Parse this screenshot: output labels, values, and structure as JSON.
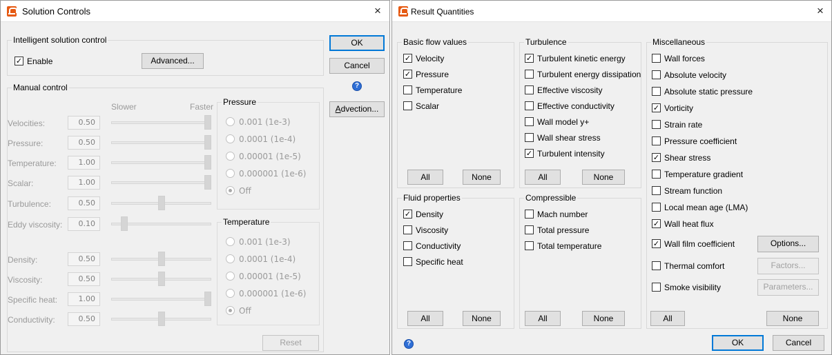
{
  "solution": {
    "title": "Solution Controls",
    "close": "×",
    "intelligent": {
      "label": "Intelligent solution control",
      "enable": "Enable",
      "enable_mark": "✓",
      "advanced": "Advanced..."
    },
    "manual": {
      "label": "Manual control",
      "slower": "Slower",
      "faster": "Faster",
      "rows": [
        {
          "label": "Velocities:",
          "value": "0.50",
          "slider": 1.0
        },
        {
          "label": "Pressure:",
          "value": "0.50",
          "slider": 1.0
        },
        {
          "label": "Temperature:",
          "value": "1.00",
          "slider": 1.0
        },
        {
          "label": "Scalar:",
          "value": "1.00",
          "slider": 1.0
        },
        {
          "label": "Turbulence:",
          "value": "0.50",
          "slider": 0.5
        },
        {
          "label": "Eddy viscosity:",
          "value": "0.10",
          "slider": 0.1
        },
        {
          "label": "Density:",
          "value": "0.50",
          "slider": 0.5
        },
        {
          "label": "Viscosity:",
          "value": "0.50",
          "slider": 0.5
        },
        {
          "label": "Specific heat:",
          "value": "1.00",
          "slider": 1.0
        },
        {
          "label": "Conductivity:",
          "value": "0.50",
          "slider": 0.5
        }
      ]
    },
    "pressure": {
      "label": "Pressure",
      "options": [
        "0.001 (1e-3)",
        "0.0001 (1e-4)",
        "0.00001 (1e-5)",
        "0.000001 (1e-6)",
        "Off"
      ],
      "selected": "Off"
    },
    "temperature": {
      "label": "Temperature",
      "options": [
        "0.001 (1e-3)",
        "0.0001 (1e-4)",
        "0.00001 (1e-5)",
        "0.000001 (1e-6)",
        "Off"
      ],
      "selected": "Off"
    },
    "buttons": {
      "ok": "OK",
      "cancel": "Cancel",
      "advection_a": "A",
      "advection_rest": "dvection...",
      "reset": "Reset"
    },
    "help": "?"
  },
  "results": {
    "title": "Result Quantities",
    "close": "×",
    "basic": {
      "label": "Basic flow values",
      "items": [
        {
          "label": "Velocity",
          "mark": "✓"
        },
        {
          "label": "Pressure",
          "mark": "✓"
        },
        {
          "label": "Temperature",
          "mark": ""
        },
        {
          "label": "Scalar",
          "mark": ""
        }
      ],
      "all": "All",
      "none": "None"
    },
    "turbulence": {
      "label": "Turbulence",
      "items": [
        {
          "label": "Turbulent kinetic energy",
          "mark": "✓"
        },
        {
          "label": "Turbulent energy dissipation",
          "mark": ""
        },
        {
          "label": "Effective viscosity",
          "mark": ""
        },
        {
          "label": "Effective conductivity",
          "mark": ""
        },
        {
          "label": "Wall model y+",
          "mark": ""
        },
        {
          "label": "Wall shear stress",
          "mark": ""
        },
        {
          "label": "Turbulent intensity",
          "mark": "✓"
        }
      ],
      "all": "All",
      "none": "None"
    },
    "fluid": {
      "label": "Fluid properties",
      "items": [
        {
          "label": "Density",
          "mark": "✓"
        },
        {
          "label": "Viscosity",
          "mark": ""
        },
        {
          "label": "Conductivity",
          "mark": ""
        },
        {
          "label": "Specific heat",
          "mark": ""
        }
      ],
      "all": "All",
      "none": "None"
    },
    "compressible": {
      "label": "Compressible",
      "items": [
        {
          "label": "Mach number",
          "mark": ""
        },
        {
          "label": "Total pressure",
          "mark": ""
        },
        {
          "label": "Total temperature",
          "mark": ""
        }
      ],
      "all": "All",
      "none": "None"
    },
    "misc": {
      "label": "Miscellaneous",
      "items": [
        {
          "label": "Wall forces",
          "mark": ""
        },
        {
          "label": "Absolute velocity",
          "mark": ""
        },
        {
          "label": "Absolute static pressure",
          "mark": ""
        },
        {
          "label": "Vorticity",
          "mark": "✓"
        },
        {
          "label": "Strain rate",
          "mark": ""
        },
        {
          "label": "Pressure coefficient",
          "mark": ""
        },
        {
          "label": "Shear stress",
          "mark": "✓"
        },
        {
          "label": "Temperature gradient",
          "mark": ""
        },
        {
          "label": "Stream function",
          "mark": ""
        },
        {
          "label": "Local mean age (LMA)",
          "mark": ""
        },
        {
          "label": "Wall heat flux",
          "mark": "✓"
        },
        {
          "label": "Wall film coefficient",
          "mark": "✓"
        },
        {
          "label": "Thermal comfort",
          "mark": ""
        },
        {
          "label": "Smoke visibility",
          "mark": ""
        }
      ],
      "options": "Options...",
      "factors": "Factors...",
      "parameters": "Parameters...",
      "all": "All",
      "none": "None"
    },
    "buttons": {
      "ok": "OK",
      "cancel": "Cancel"
    },
    "help": "?"
  },
  "colors": {
    "accent": "#0078d7",
    "app_icon": "#e65a12",
    "help": "#2f6fd6"
  }
}
